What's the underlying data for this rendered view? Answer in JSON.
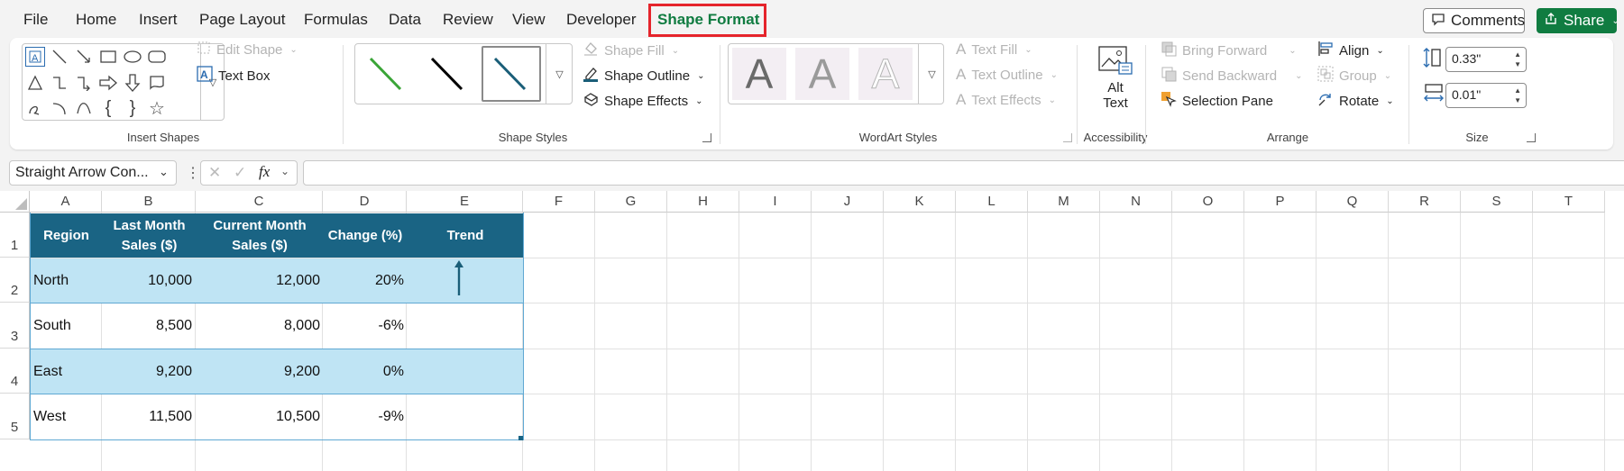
{
  "menu_tabs": [
    "File",
    "Home",
    "Insert",
    "Page Layout",
    "Formulas",
    "Data",
    "Review",
    "View",
    "Developer",
    "Shape Format"
  ],
  "active_tab": "Shape Format",
  "comments_label": "Comments",
  "share_label": "Share",
  "ribbon": {
    "insert_shapes": {
      "label": "Insert Shapes",
      "edit_shape": "Edit Shape",
      "text_box": "Text Box"
    },
    "shape_styles": {
      "label": "Shape Styles",
      "shape_fill": "Shape Fill",
      "shape_outline": "Shape Outline",
      "shape_effects": "Shape Effects",
      "style_colors": [
        "#3aa537",
        "#000000",
        "#1a5e78"
      ]
    },
    "wordart_styles": {
      "label": "WordArt Styles",
      "text_fill": "Text Fill",
      "text_outline": "Text Outline",
      "text_effects": "Text Effects",
      "sample_letter": "A"
    },
    "accessibility": {
      "label": "Accessibility",
      "alt_text_line1": "Alt",
      "alt_text_line2": "Text"
    },
    "arrange": {
      "label": "Arrange",
      "bring_forward": "Bring Forward",
      "send_backward": "Send Backward",
      "selection_pane": "Selection Pane",
      "align": "Align",
      "group": "Group",
      "rotate": "Rotate"
    },
    "size": {
      "label": "Size",
      "height": "0.33\"",
      "width": "0.01\""
    }
  },
  "formula_bar": {
    "name_box": "Straight Arrow Con...",
    "formula": ""
  },
  "columns": [
    "A",
    "B",
    "C",
    "D",
    "E",
    "F",
    "G",
    "H",
    "I",
    "J",
    "K",
    "L",
    "M",
    "N",
    "O",
    "P",
    "Q",
    "R",
    "S",
    "T"
  ],
  "rows": [
    "1",
    "2",
    "3",
    "4",
    "5"
  ],
  "table": {
    "headers": [
      [
        "Region"
      ],
      [
        "Last Month",
        "Sales ($)"
      ],
      [
        "Current Month",
        "Sales ($)"
      ],
      [
        "Change (%)"
      ],
      [
        "Trend"
      ]
    ],
    "rows": [
      [
        "North",
        "10,000",
        "12,000",
        "20%"
      ],
      [
        "South",
        "8,500",
        "8,000",
        "-6%"
      ],
      [
        "East",
        "9,200",
        "9,200",
        "0%"
      ],
      [
        "West",
        "11,500",
        "10,500",
        "-9%"
      ]
    ]
  },
  "colors": {
    "header_bg": "#1a6484",
    "band_bg": "#bfe4f4",
    "accent_green": "#107c41",
    "highlight_red": "#e5242b",
    "arrow": "#1a5e78"
  }
}
